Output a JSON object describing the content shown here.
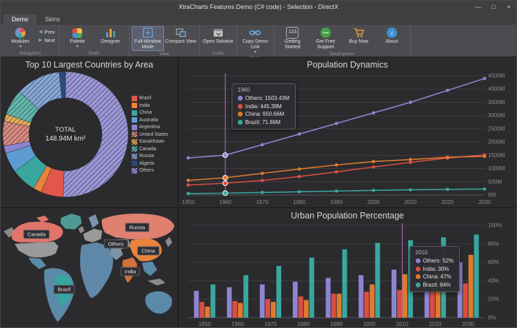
{
  "window": {
    "title": "XtraCharts Features Demo (C# code) - Selection - DirectX",
    "minimize": "—",
    "maximize": "□",
    "close": "×"
  },
  "ribbon": {
    "tabs": [
      {
        "label": "Demo"
      },
      {
        "label": "Skins"
      }
    ],
    "navigation": {
      "caption": "Navigation",
      "modules": "Modules",
      "prev": "Prev",
      "next": "Next"
    },
    "chart": {
      "caption": "Chart",
      "palette": "Palette",
      "designer": "Designer"
    },
    "view": {
      "caption": "View",
      "full_window": "Full-Window Mode",
      "compact": "Compact View"
    },
    "code": {
      "caption": "Code",
      "open_solution": "Open Solution"
    },
    "share": {
      "caption": "Share",
      "copy_link": "Copy Demo Link"
    },
    "devexpress": {
      "caption": "DevExpress",
      "getting_started": "Getting Started",
      "support": "Get Free Support",
      "buy": "Buy Now",
      "about": "About",
      "badge_123": "123"
    }
  },
  "chart_data": [
    {
      "type": "pie",
      "title": "Top 10 Largest Countries by Area",
      "center_label": "TOTAL",
      "center_value": "148.94M km²",
      "units": "M km²",
      "slices": [
        {
          "label": "Brazil",
          "value": 8.51,
          "color": "#e2574c",
          "hatched": false
        },
        {
          "label": "India",
          "value": 3.29,
          "color": "#e8823c",
          "hatched": false
        },
        {
          "label": "China",
          "value": 9.6,
          "color": "#3aa79f",
          "hatched": false
        },
        {
          "label": "Australia",
          "value": 7.69,
          "color": "#5e9bd1",
          "hatched": false
        },
        {
          "label": "Argentina",
          "value": 2.78,
          "color": "#8e85d2",
          "hatched": false
        },
        {
          "label": "United States",
          "value": 9.52,
          "color": "#d98a80",
          "hatched": true
        },
        {
          "label": "Kazakhstan",
          "value": 2.72,
          "color": "#e8b05a",
          "hatched": true
        },
        {
          "label": "Canada",
          "value": 9.98,
          "color": "#63b8ae",
          "hatched": true
        },
        {
          "label": "Russia",
          "value": 17.1,
          "color": "#86a8d8",
          "hatched": true
        },
        {
          "label": "Algeria",
          "value": 2.38,
          "color": "#2e4a7a",
          "hatched": false
        },
        {
          "label": "Others",
          "value": 75.37,
          "color": "#9b97d8",
          "hatched": true
        }
      ]
    },
    {
      "type": "line",
      "title": "Population Dynamics",
      "x": [
        1950,
        1960,
        1970,
        1980,
        1990,
        2000,
        2010,
        2020,
        2030
      ],
      "ylim": [
        0,
        4500
      ],
      "yticks": [
        {
          "value": 0,
          "label": "0M"
        },
        {
          "value": 500,
          "label": "500M"
        },
        {
          "value": 1000,
          "label": "1000M"
        },
        {
          "value": 1500,
          "label": "1500M"
        },
        {
          "value": 2000,
          "label": "2000M"
        },
        {
          "value": 2500,
          "label": "2500M"
        },
        {
          "value": 3000,
          "label": "3000M"
        },
        {
          "value": 3500,
          "label": "3500M"
        },
        {
          "value": 4000,
          "label": "4000M"
        },
        {
          "value": 4500,
          "label": "4500M"
        }
      ],
      "crosshair_index": 1,
      "crosshair_color": "#a864a8",
      "series": [
        {
          "name": "Others",
          "color": "#8e85d2",
          "values": [
            1400,
            1503.43,
            1900,
            2300,
            2700,
            3100,
            3500,
            3950,
            4400
          ]
        },
        {
          "name": "India",
          "color": "#d94f43",
          "values": [
            376,
            445.39,
            548,
            697,
            873,
            1057,
            1234,
            1396,
            1515
          ]
        },
        {
          "name": "China",
          "color": "#e07b2e",
          "values": [
            554,
            650.66,
            818,
            981,
            1135,
            1263,
            1338,
            1425,
            1460
          ]
        },
        {
          "name": "Brazil",
          "color": "#3aa79f",
          "values": [
            54,
            71.69,
            96,
            122,
            149,
            175,
            196,
            213,
            225
          ]
        }
      ],
      "tooltip": {
        "title": "1960",
        "entries": [
          {
            "name": "Others",
            "value": "1503.43M",
            "color": "#8e85d2"
          },
          {
            "name": "India",
            "value": "445.39M",
            "color": "#d94f43"
          },
          {
            "name": "China",
            "value": "650.66M",
            "color": "#e07b2e"
          },
          {
            "name": "Brazil",
            "value": "71.69M",
            "color": "#3aa79f"
          }
        ]
      }
    },
    {
      "type": "map",
      "regions": {
        "greenland": "#4f9a94",
        "alaska": "#8b8b8b",
        "canada": "#e0756b",
        "canada_islands": "#e0756b",
        "usa": "#9a9a9a",
        "mexico": "#5b8aa8",
        "south_america": "#5b8aa8",
        "brazil": "#35a79f",
        "europe": "#9a9a9a",
        "uk": "#8b8b8b",
        "scandinavia": "#7a93a8",
        "africa": "#6088a8",
        "arabia": "#7a93a8",
        "russia": "#e08070",
        "central_asia": "#8b8b8b",
        "china": "#e8823c",
        "india": "#d4703a",
        "se_asia": "#5b8aa8",
        "indonesia": "#8b8b8b",
        "japan": "#8b8b8b",
        "australia": "#5b8aa8"
      },
      "labels": [
        {
          "text": "Canada",
          "x": 52,
          "y": 38
        },
        {
          "text": "Russia",
          "x": 198,
          "y": 28
        },
        {
          "text": "Others",
          "x": 167,
          "y": 52
        },
        {
          "text": "China",
          "x": 214,
          "y": 62
        },
        {
          "text": "India",
          "x": 188,
          "y": 92
        },
        {
          "text": "Brazil",
          "x": 92,
          "y": 118
        }
      ]
    },
    {
      "type": "bar",
      "title": "Urban Population Percentage",
      "categories": [
        1950,
        1960,
        1970,
        1980,
        1990,
        2000,
        2010,
        2020,
        2030
      ],
      "ylim": [
        0,
        100
      ],
      "yticks": [
        {
          "value": 0,
          "label": "0%"
        },
        {
          "value": 20,
          "label": "20%"
        },
        {
          "value": 40,
          "label": "40%"
        },
        {
          "value": 60,
          "label": "60%"
        },
        {
          "value": 80,
          "label": "80%"
        },
        {
          "value": 100,
          "label": "100%"
        }
      ],
      "crosshair_index": 6,
      "crosshair_color": "#a864a8",
      "series": [
        {
          "name": "Others",
          "color": "#8e85d2",
          "values": [
            29,
            33,
            36,
            39,
            43,
            46,
            52,
            56,
            60
          ]
        },
        {
          "name": "India",
          "color": "#d94f43",
          "values": [
            17,
            18,
            20,
            23,
            26,
            28,
            30,
            33,
            37
          ]
        },
        {
          "name": "China",
          "color": "#e07b2e",
          "values": [
            12,
            16,
            17,
            19,
            26,
            36,
            47,
            58,
            68
          ]
        },
        {
          "name": "Brazil",
          "color": "#3aa79f",
          "values": [
            36,
            46,
            56,
            65,
            74,
            81,
            84,
            87,
            90
          ]
        }
      ],
      "tooltip": {
        "title": "2010",
        "entries": [
          {
            "name": "Others",
            "value": "52%",
            "color": "#8e85d2"
          },
          {
            "name": "India",
            "value": "30%",
            "color": "#d94f43"
          },
          {
            "name": "China",
            "value": "47%",
            "color": "#e07b2e"
          },
          {
            "name": "Brazil",
            "value": "84%",
            "color": "#3aa79f"
          }
        ]
      }
    }
  ]
}
